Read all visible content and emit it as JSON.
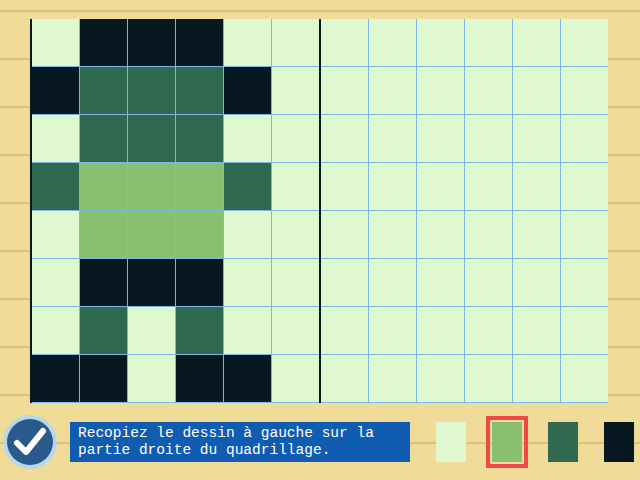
{
  "instruction": "Recopiez le dessin à gauche sur la partie droite du quadrillage.",
  "model_grid": {
    "cells": [
      [
        "#e0f8d0",
        "#081820",
        "#081820",
        "#081820",
        "#e0f8d0",
        "#e0f8d0"
      ],
      [
        "#081820",
        "#306850",
        "#306850",
        "#306850",
        "#081820",
        "#e0f8d0"
      ],
      [
        "#e0f8d0",
        "#306850",
        "#306850",
        "#306850",
        "#e0f8d0",
        "#e0f8d0"
      ],
      [
        "#306850",
        "#88c070",
        "#88c070",
        "#88c070",
        "#306850",
        "#e0f8d0"
      ],
      [
        "#e0f8d0",
        "#88c070",
        "#88c070",
        "#88c070",
        "#e0f8d0",
        "#e0f8d0"
      ],
      [
        "#e0f8d0",
        "#081820",
        "#081820",
        "#081820",
        "#e0f8d0",
        "#e0f8d0"
      ],
      [
        "#e0f8d0",
        "#306850",
        "#e0f8d0",
        "#306850",
        "#e0f8d0",
        "#e0f8d0"
      ],
      [
        "#081820",
        "#081820",
        "#e0f8d0",
        "#081820",
        "#081820",
        "#e0f8d0"
      ]
    ]
  },
  "copy_grid": {
    "cells": [
      [
        "#e0f8d0",
        "#e0f8d0",
        "#e0f8d0",
        "#e0f8d0",
        "#e0f8d0",
        "#e0f8d0"
      ],
      [
        "#e0f8d0",
        "#e0f8d0",
        "#e0f8d0",
        "#e0f8d0",
        "#e0f8d0",
        "#e0f8d0"
      ],
      [
        "#e0f8d0",
        "#e0f8d0",
        "#e0f8d0",
        "#e0f8d0",
        "#e0f8d0",
        "#e0f8d0"
      ],
      [
        "#e0f8d0",
        "#e0f8d0",
        "#e0f8d0",
        "#e0f8d0",
        "#e0f8d0",
        "#e0f8d0"
      ],
      [
        "#e0f8d0",
        "#e0f8d0",
        "#e0f8d0",
        "#e0f8d0",
        "#e0f8d0",
        "#e0f8d0"
      ],
      [
        "#e0f8d0",
        "#e0f8d0",
        "#e0f8d0",
        "#e0f8d0",
        "#e0f8d0",
        "#e0f8d0"
      ],
      [
        "#e0f8d0",
        "#e0f8d0",
        "#e0f8d0",
        "#e0f8d0",
        "#e0f8d0",
        "#e0f8d0"
      ],
      [
        "#e0f8d0",
        "#e0f8d0",
        "#e0f8d0",
        "#e0f8d0",
        "#e0f8d0",
        "#e0f8d0"
      ]
    ]
  },
  "palette": [
    {
      "color": "#e0f8d0",
      "selected": false
    },
    {
      "color": "#88c070",
      "selected": true
    },
    {
      "color": "#306850",
      "selected": false
    },
    {
      "color": "#081820",
      "selected": false
    }
  ]
}
